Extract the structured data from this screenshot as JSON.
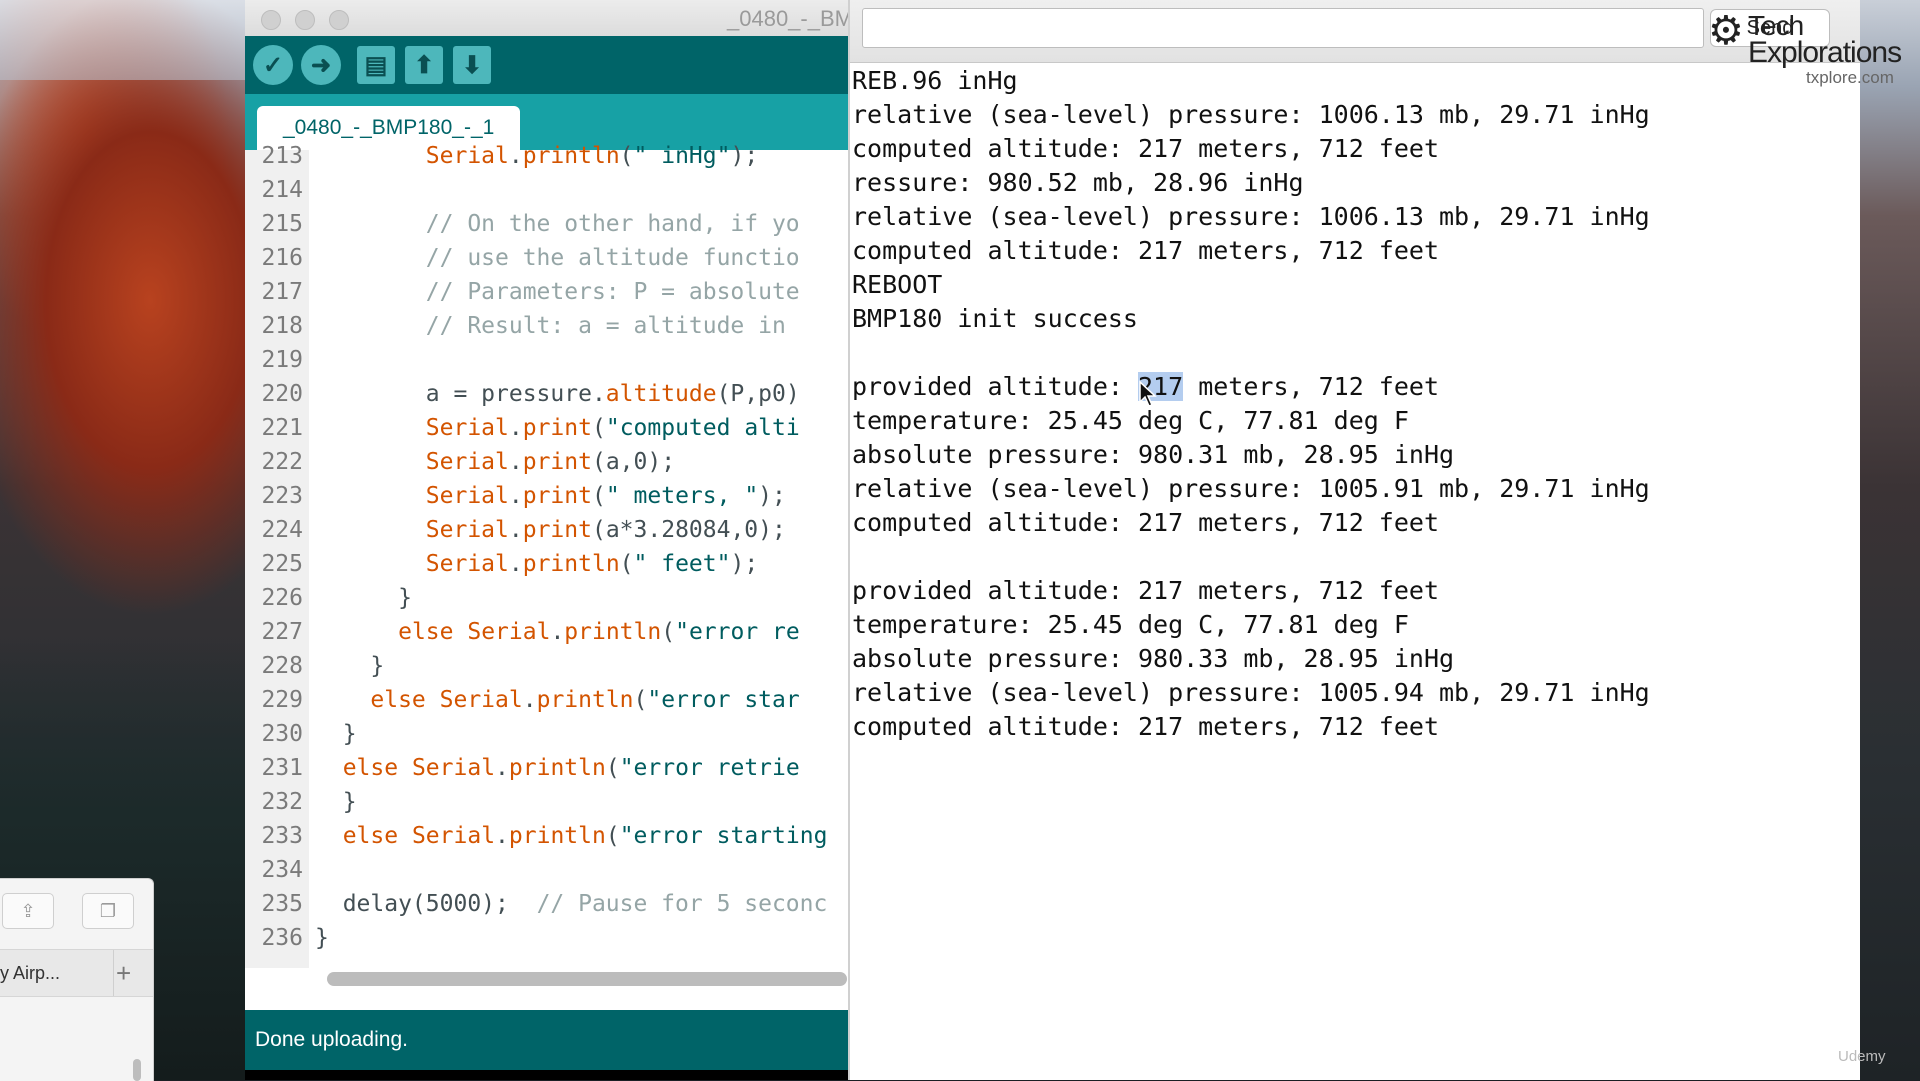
{
  "ide": {
    "window_title": "_0480_-_BMP180_-_1",
    "tab_label": "_0480_-_BMP180_-_1",
    "toolbar": {
      "verify_icon": "check-icon",
      "upload_icon": "arrow-right-icon",
      "new_icon": "file-icon",
      "open_icon": "arrow-up-icon",
      "save_icon": "arrow-down-icon"
    },
    "code_lines": [
      {
        "num": "213",
        "text": "        Serial.println(\" inHg\");"
      },
      {
        "num": "214",
        "text": ""
      },
      {
        "num": "215",
        "text": "        // On the other hand, if yo"
      },
      {
        "num": "216",
        "text": "        // use the altitude functio"
      },
      {
        "num": "217",
        "text": "        // Parameters: P = absolute"
      },
      {
        "num": "218",
        "text": "        // Result: a = altitude in "
      },
      {
        "num": "219",
        "text": ""
      },
      {
        "num": "220",
        "text": "        a = pressure.altitude(P,p0)"
      },
      {
        "num": "221",
        "text": "        Serial.print(\"computed alti"
      },
      {
        "num": "222",
        "text": "        Serial.print(a,0);"
      },
      {
        "num": "223",
        "text": "        Serial.print(\" meters, \");"
      },
      {
        "num": "224",
        "text": "        Serial.print(a*3.28084,0);"
      },
      {
        "num": "225",
        "text": "        Serial.println(\" feet\");"
      },
      {
        "num": "226",
        "text": "      }"
      },
      {
        "num": "227",
        "text": "      else Serial.println(\"error re"
      },
      {
        "num": "228",
        "text": "    }"
      },
      {
        "num": "229",
        "text": "    else Serial.println(\"error star"
      },
      {
        "num": "230",
        "text": "  }"
      },
      {
        "num": "231",
        "text": "  else Serial.println(\"error retrie"
      },
      {
        "num": "232",
        "text": "  }"
      },
      {
        "num": "233",
        "text": "  else Serial.println(\"error starting"
      },
      {
        "num": "234",
        "text": ""
      },
      {
        "num": "235",
        "text": "  delay(5000);  // Pause for 5 seconc"
      },
      {
        "num": "236",
        "text": "}"
      }
    ],
    "status": "Done uploading."
  },
  "serial": {
    "send_label": "Send",
    "input_value": "",
    "lines": [
      "REB.96 inHg",
      "relative (sea-level) pressure: 1006.13 mb, 29.71 inHg",
      "computed altitude: 217 meters, 712 feet",
      "ressure: 980.52 mb, 28.96 inHg",
      "relative (sea-level) pressure: 1006.13 mb, 29.71 inHg",
      "computed altitude: 217 meters, 712 feet",
      "REBOOT",
      "BMP180 init success",
      "",
      "provided altitude: 217 meters, 712 feet",
      "temperature: 25.45 deg C, 77.81 deg F",
      "absolute pressure: 980.31 mb, 28.95 inHg",
      "relative (sea-level) pressure: 1005.91 mb, 29.71 inHg",
      "computed altitude: 217 meters, 712 feet",
      "",
      "provided altitude: 217 meters, 712 feet",
      "temperature: 25.45 deg C, 77.81 deg F",
      "absolute pressure: 980.33 mb, 28.95 inHg",
      "relative (sea-level) pressure: 1005.94 mb, 29.71 inHg",
      "computed altitude: 217 meters, 712 feet"
    ],
    "selected_text": "217"
  },
  "finder": {
    "share_icon": "share-icon",
    "tabs_icon": "tabs-icon",
    "tab_label": "y Airp...",
    "add_label": "+"
  },
  "watermark": {
    "line1": "Tech",
    "line2": "Explorations",
    "site": "txplore.com",
    "udemy": "Udemy"
  },
  "colors": {
    "ide_toolbar": "#006468",
    "ide_tabbar": "#17a1a5",
    "selection": "#b4cdef"
  }
}
